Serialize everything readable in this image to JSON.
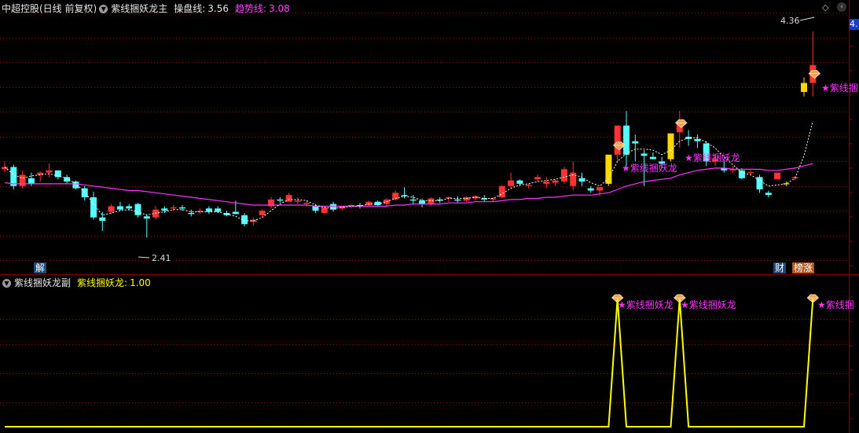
{
  "main_header": {
    "stock": "中超控股(日线 前复权)",
    "indicator": "紫线捆妖龙主",
    "line1_label": "操盘线:",
    "line1_value": "3.56",
    "line2_label": "趋势线:",
    "line2_value": "3.08"
  },
  "sub_header": {
    "indicator": "紫线捆妖龙副",
    "label": "紫线捆妖龙:",
    "value": "1.00"
  },
  "annotations": {
    "high_label": "4.36",
    "low_label": "2.41",
    "signal_text": "紫线捆妖龙",
    "signal_text_clipped": "紫线捆",
    "tag_jie": "解",
    "tag_cai": "财",
    "tag_bangzhang": "榜涨",
    "price_axis_tag": "4."
  },
  "colors": {
    "up": "#ff3232",
    "down": "#54ffff",
    "limit_up": "#ffd700",
    "trend_line": "#ff33ff",
    "ops_line": "#ffffff",
    "grid": "#8b0000",
    "signal_line": "#ffff00",
    "signal_text": "#ff33ff"
  },
  "chart_data": [
    {
      "type": "candlestick",
      "title": "中超控股(日线 前复权)",
      "ylim": [
        2.2,
        4.5
      ],
      "candles": [
        [
          3.13,
          3.2,
          3.1,
          3.15
        ],
        [
          3.15,
          3.17,
          2.95,
          2.98
        ],
        [
          2.98,
          3.12,
          2.96,
          3.08
        ],
        [
          3.05,
          3.1,
          2.98,
          3.0
        ],
        [
          3.08,
          3.11,
          3.02,
          3.1
        ],
        [
          3.1,
          3.18,
          3.06,
          3.12
        ],
        [
          3.12,
          3.12,
          3.04,
          3.06
        ],
        [
          3.06,
          3.08,
          3.0,
          3.02
        ],
        [
          3.02,
          3.03,
          2.95,
          2.96
        ],
        [
          2.96,
          2.98,
          2.85,
          2.88
        ],
        [
          2.88,
          2.93,
          2.68,
          2.7
        ],
        [
          2.7,
          2.75,
          2.58,
          2.67
        ],
        [
          2.75,
          2.82,
          2.73,
          2.8
        ],
        [
          2.8,
          2.84,
          2.76,
          2.77
        ],
        [
          2.8,
          2.82,
          2.76,
          2.78
        ],
        [
          2.82,
          2.83,
          2.7,
          2.72
        ],
        [
          2.71,
          2.73,
          2.52,
          2.69
        ],
        [
          2.7,
          2.8,
          2.68,
          2.77
        ],
        [
          2.78,
          2.8,
          2.74,
          2.76
        ],
        [
          2.78,
          2.81,
          2.76,
          2.79
        ],
        [
          2.79,
          2.81,
          2.76,
          2.78
        ],
        [
          2.74,
          2.77,
          2.71,
          2.73
        ],
        [
          2.75,
          2.78,
          2.73,
          2.76
        ],
        [
          2.78,
          2.8,
          2.73,
          2.75
        ],
        [
          2.78,
          2.8,
          2.74,
          2.75
        ],
        [
          2.74,
          2.76,
          2.71,
          2.72
        ],
        [
          2.75,
          2.85,
          2.74,
          2.73
        ],
        [
          2.72,
          2.74,
          2.62,
          2.64
        ],
        [
          2.66,
          2.7,
          2.63,
          2.68
        ],
        [
          2.72,
          2.77,
          2.7,
          2.76
        ],
        [
          2.8,
          2.88,
          2.78,
          2.86
        ],
        [
          2.86,
          2.88,
          2.83,
          2.85
        ],
        [
          2.84,
          2.92,
          2.85,
          2.9
        ],
        [
          2.84,
          2.88,
          2.82,
          2.85
        ],
        [
          2.82,
          2.85,
          2.8,
          2.83
        ],
        [
          2.8,
          2.82,
          2.74,
          2.76
        ],
        [
          2.74,
          2.8,
          2.75,
          2.79
        ],
        [
          2.82,
          2.84,
          2.75,
          2.77
        ],
        [
          2.78,
          2.8,
          2.77,
          2.8
        ],
        [
          2.8,
          2.82,
          2.78,
          2.81
        ],
        [
          2.81,
          2.83,
          2.78,
          2.8
        ],
        [
          2.81,
          2.85,
          2.8,
          2.84
        ],
        [
          2.84,
          2.85,
          2.8,
          2.81
        ],
        [
          2.82,
          2.87,
          2.8,
          2.86
        ],
        [
          2.86,
          2.94,
          2.85,
          2.92
        ],
        [
          2.9,
          2.97,
          2.87,
          2.89
        ],
        [
          2.86,
          2.9,
          2.82,
          2.85
        ],
        [
          2.85,
          2.87,
          2.79,
          2.82
        ],
        [
          2.82,
          2.88,
          2.8,
          2.87
        ],
        [
          2.86,
          2.88,
          2.83,
          2.85
        ],
        [
          2.87,
          2.89,
          2.84,
          2.88
        ],
        [
          2.86,
          2.89,
          2.83,
          2.85
        ],
        [
          2.85,
          2.89,
          2.84,
          2.88
        ],
        [
          2.87,
          2.9,
          2.85,
          2.89
        ],
        [
          2.87,
          2.9,
          2.84,
          2.86
        ],
        [
          2.86,
          2.88,
          2.84,
          2.87
        ],
        [
          2.88,
          2.99,
          2.87,
          2.98
        ],
        [
          2.98,
          3.1,
          2.96,
          3.03
        ],
        [
          3.03,
          3.04,
          2.98,
          3.0
        ],
        [
          2.98,
          3.0,
          2.96,
          2.99
        ],
        [
          3.04,
          3.08,
          3.02,
          3.06
        ],
        [
          3.0,
          3.06,
          2.96,
          3.02
        ],
        [
          3.01,
          3.04,
          2.98,
          3.03
        ],
        [
          3.02,
          3.15,
          3.0,
          3.13
        ],
        [
          2.98,
          3.2,
          2.94,
          3.1
        ],
        [
          3.05,
          3.1,
          2.98,
          3.02
        ],
        [
          2.96,
          2.98,
          2.92,
          2.94
        ],
        [
          2.94,
          2.97,
          2.89,
          2.97
        ],
        [
          3.0,
          3.26,
          2.98,
          3.26
        ],
        [
          3.26,
          3.52,
          3.2,
          3.52
        ],
        [
          3.52,
          3.65,
          3.16,
          3.26
        ],
        [
          3.38,
          3.44,
          3.2,
          3.36
        ],
        [
          3.27,
          3.3,
          2.98,
          3.25
        ],
        [
          3.24,
          3.28,
          3.22,
          3.22
        ],
        [
          3.2,
          3.24,
          3.14,
          3.18
        ],
        [
          3.22,
          3.45,
          3.2,
          3.45
        ],
        [
          3.46,
          3.65,
          3.32,
          3.56
        ],
        [
          3.42,
          3.48,
          3.34,
          3.4
        ],
        [
          3.4,
          3.44,
          3.32,
          3.38
        ],
        [
          3.36,
          3.38,
          3.16,
          3.2
        ],
        [
          3.2,
          3.26,
          3.16,
          3.22
        ],
        [
          3.14,
          3.2,
          3.1,
          3.12
        ],
        [
          3.12,
          3.16,
          3.1,
          3.13
        ],
        [
          3.12,
          3.14,
          3.04,
          3.05
        ],
        [
          3.1,
          3.12,
          3.08,
          3.1
        ],
        [
          3.06,
          3.08,
          2.92,
          2.95
        ],
        [
          2.92,
          2.94,
          2.88,
          2.9
        ],
        [
          3.04,
          3.1,
          3.04,
          3.1
        ],
        [
          3.0,
          3.02,
          2.98,
          3.0
        ],
        [
          3.05,
          3.07,
          3.03,
          3.06
        ],
        [
          3.9,
          3.95,
          3.78,
          3.82
        ],
        [
          3.9,
          4.36,
          3.78,
          4.06
        ]
      ],
      "series": [
        {
          "name": "操盘线",
          "values": [
            3.15,
            3.08,
            3.05,
            3.07,
            3.08,
            3.09,
            3.07,
            3.05,
            3.0,
            2.93,
            2.82,
            2.72,
            2.74,
            2.76,
            2.77,
            2.75,
            2.72,
            2.74,
            2.75,
            2.77,
            2.77,
            2.75,
            2.75,
            2.75,
            2.75,
            2.73,
            2.71,
            2.67,
            2.67,
            2.7,
            2.76,
            2.82,
            2.86,
            2.86,
            2.85,
            2.81,
            2.79,
            2.78,
            2.79,
            2.8,
            2.8,
            2.82,
            2.82,
            2.84,
            2.87,
            2.89,
            2.88,
            2.85,
            2.85,
            2.85,
            2.87,
            2.87,
            2.87,
            2.88,
            2.87,
            2.87,
            2.91,
            2.96,
            2.99,
            3.0,
            3.02,
            3.03,
            3.04,
            3.06,
            3.08,
            3.06,
            3.01,
            2.98,
            3.05,
            3.2,
            3.27,
            3.31,
            3.31,
            3.3,
            3.26,
            3.3,
            3.38,
            3.41,
            3.41,
            3.37,
            3.32,
            3.24,
            3.17,
            3.1,
            3.08,
            3.03,
            2.98,
            2.99,
            3.0,
            3.05,
            3.25,
            3.56
          ]
        },
        {
          "name": "趋势线",
          "values": [
            3.01,
            3.0,
            3.0,
            3.0,
            3.0,
            3.0,
            3.0,
            3.0,
            3.0,
            2.99,
            2.98,
            2.97,
            2.96,
            2.95,
            2.94,
            2.94,
            2.93,
            2.92,
            2.91,
            2.9,
            2.89,
            2.88,
            2.87,
            2.86,
            2.85,
            2.84,
            2.83,
            2.82,
            2.81,
            2.81,
            2.81,
            2.81,
            2.81,
            2.81,
            2.81,
            2.8,
            2.8,
            2.8,
            2.8,
            2.8,
            2.8,
            2.8,
            2.8,
            2.8,
            2.81,
            2.81,
            2.82,
            2.82,
            2.82,
            2.82,
            2.83,
            2.83,
            2.83,
            2.84,
            2.84,
            2.84,
            2.85,
            2.86,
            2.86,
            2.87,
            2.87,
            2.88,
            2.88,
            2.89,
            2.9,
            2.9,
            2.9,
            2.91,
            2.92,
            2.95,
            2.98,
            3.0,
            3.02,
            3.03,
            3.04,
            3.05,
            3.08,
            3.1,
            3.12,
            3.13,
            3.14,
            3.14,
            3.13,
            3.13,
            3.13,
            3.13,
            3.12,
            3.12,
            3.13,
            3.14,
            3.16,
            3.18
          ]
        }
      ],
      "signals": [
        {
          "index": 69,
          "label": "紫线捆妖龙"
        },
        {
          "index": 76,
          "label": "紫线捆妖龙"
        },
        {
          "index": 91,
          "label": "紫线捆"
        }
      ],
      "extremes": {
        "high": 4.36,
        "low": 2.41
      }
    },
    {
      "type": "line",
      "title": "紫线捆妖龙副",
      "ylim": [
        0,
        1
      ],
      "series": [
        {
          "name": "紫线捆妖龙",
          "spike_indices": [
            69,
            76,
            91
          ],
          "value_on": 1.0,
          "value_off": 0.0
        }
      ]
    }
  ]
}
